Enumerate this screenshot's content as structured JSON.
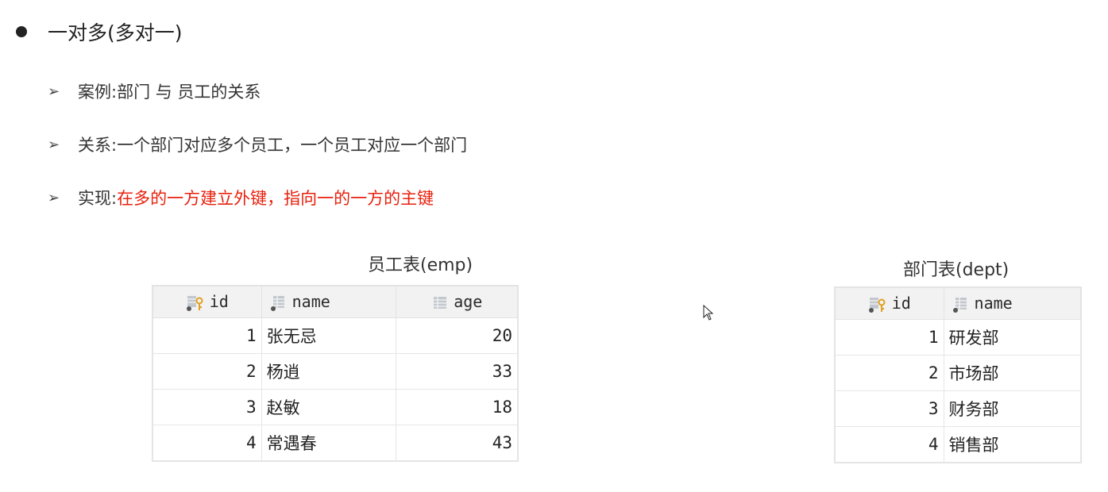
{
  "heading": "一对多(多对一)",
  "bullets": [
    {
      "label": "案例: ",
      "value": "部门 与 员工的关系"
    },
    {
      "label": "关系: ",
      "value": "一个部门对应多个员工，一个员工对应一个部门"
    },
    {
      "label": "实现: ",
      "value": "在多的一方建立外键，指向一的一方的主键"
    }
  ],
  "colors": {
    "highlight": "#e8200c",
    "text": "#333333"
  },
  "emp": {
    "title": "员工表(emp)",
    "columns": [
      "id",
      "name",
      "age"
    ],
    "rows": [
      [
        "1",
        "张无忌",
        "20"
      ],
      [
        "2",
        "杨逍",
        "33"
      ],
      [
        "3",
        "赵敏",
        "18"
      ],
      [
        "4",
        "常遇春",
        "43"
      ]
    ]
  },
  "dept": {
    "title": "部门表(dept)",
    "columns": [
      "id",
      "name"
    ],
    "rows": [
      [
        "1",
        "研发部"
      ],
      [
        "2",
        "市场部"
      ],
      [
        "3",
        "财务部"
      ],
      [
        "4",
        "销售部"
      ]
    ]
  },
  "icons": {
    "key_column": "primary-key-column-icon",
    "column": "table-column-icon",
    "cursor": "mouse-cursor-icon"
  }
}
